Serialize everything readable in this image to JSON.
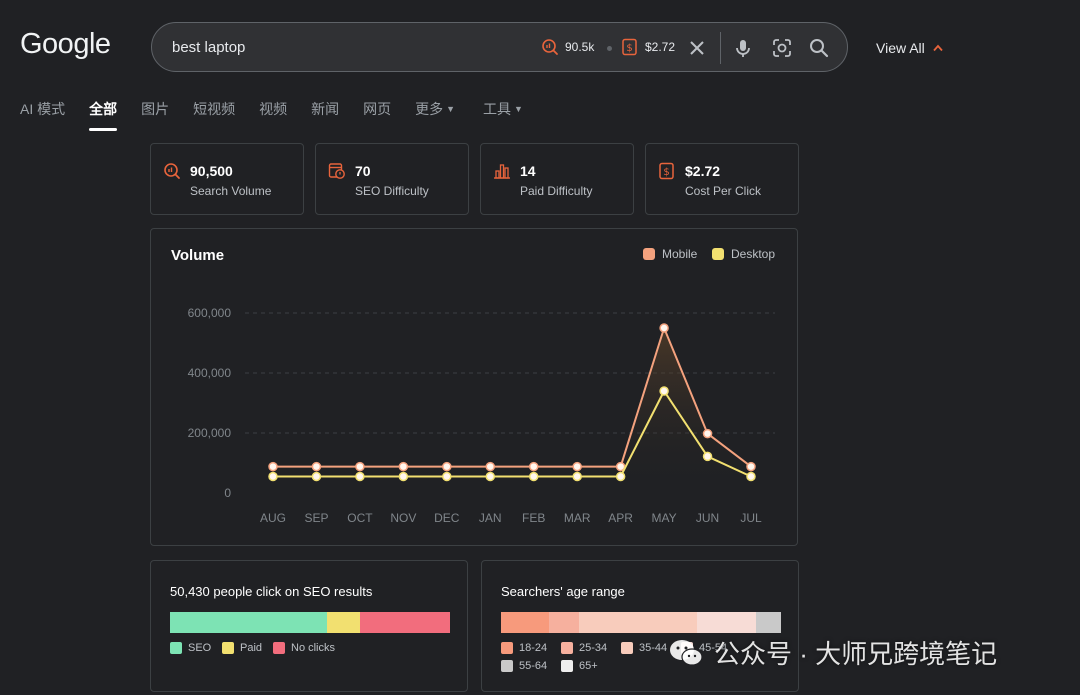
{
  "logo": "Google",
  "search": {
    "query": "best laptop",
    "volume_chip": "90.5k",
    "cpc_chip": "$2.72",
    "view_all": "View All"
  },
  "tabs": [
    {
      "label": "AI 模式",
      "active": false,
      "dropdown": false
    },
    {
      "label": "全部",
      "active": true,
      "dropdown": false
    },
    {
      "label": "图片",
      "active": false,
      "dropdown": false
    },
    {
      "label": "短视频",
      "active": false,
      "dropdown": false
    },
    {
      "label": "视频",
      "active": false,
      "dropdown": false
    },
    {
      "label": "新闻",
      "active": false,
      "dropdown": false
    },
    {
      "label": "网页",
      "active": false,
      "dropdown": false
    },
    {
      "label": "更多",
      "active": false,
      "dropdown": true
    },
    {
      "label": "工具",
      "active": false,
      "dropdown": true
    }
  ],
  "stats": [
    {
      "value": "90,500",
      "label": "Search Volume",
      "icon": "search-volume-icon"
    },
    {
      "value": "70",
      "label": "SEO Difficulty",
      "icon": "seo-difficulty-icon"
    },
    {
      "value": "14",
      "label": "Paid Difficulty",
      "icon": "paid-difficulty-icon"
    },
    {
      "value": "$2.72",
      "label": "Cost Per Click",
      "icon": "cost-per-click-icon"
    }
  ],
  "accent_color": "#e8643c",
  "volume": {
    "title": "Volume",
    "legend": [
      {
        "name": "Mobile",
        "color": "#f4a27e"
      },
      {
        "name": "Desktop",
        "color": "#f2e070"
      }
    ]
  },
  "chart_data": {
    "type": "line",
    "title": "Volume",
    "categories": [
      "AUG",
      "SEP",
      "OCT",
      "NOV",
      "DEC",
      "JAN",
      "FEB",
      "MAR",
      "APR",
      "MAY",
      "JUN",
      "JUL"
    ],
    "y_ticks": [
      "600,000",
      "400,000",
      "200,000",
      "0"
    ],
    "ylim": [
      0,
      600000
    ],
    "grid": "horizontal dashed",
    "legend_position": "top-right",
    "series": [
      {
        "name": "Mobile",
        "color": "#f4a27e",
        "values": [
          88000,
          88000,
          88000,
          88000,
          88000,
          88000,
          88000,
          88000,
          88000,
          550000,
          198000,
          88000
        ]
      },
      {
        "name": "Desktop",
        "color": "#f2e070",
        "values": [
          55000,
          55000,
          55000,
          55000,
          55000,
          55000,
          55000,
          55000,
          55000,
          340000,
          122000,
          55000
        ]
      }
    ]
  },
  "seo_clicks": {
    "title": "50,430 people click on SEO results",
    "segments": [
      {
        "name": "SEO",
        "share": 0.56,
        "color": "#7de3b4"
      },
      {
        "name": "Paid",
        "share": 0.12,
        "color": "#f2e070"
      },
      {
        "name": "No clicks",
        "share": 0.32,
        "color": "#f26d7d"
      }
    ]
  },
  "age_range": {
    "title": "Searchers' age range",
    "segments": [
      {
        "name": "18-24",
        "share": 0.17,
        "color": "#f79a7c"
      },
      {
        "name": "25-34",
        "share": 0.11,
        "color": "#f6b09e"
      },
      {
        "name": "35-44",
        "share": 0.42,
        "color": "#f8ccbc"
      },
      {
        "name": "45-54",
        "share": 0.21,
        "color": "#f7dcd6"
      },
      {
        "name": "55-64",
        "share": 0.09,
        "color": "#c9c9c9"
      },
      {
        "name": "65+",
        "share": 0.0,
        "color": "#eeeeee"
      }
    ]
  },
  "watermark": "公众号 · 大师兄跨境笔记"
}
